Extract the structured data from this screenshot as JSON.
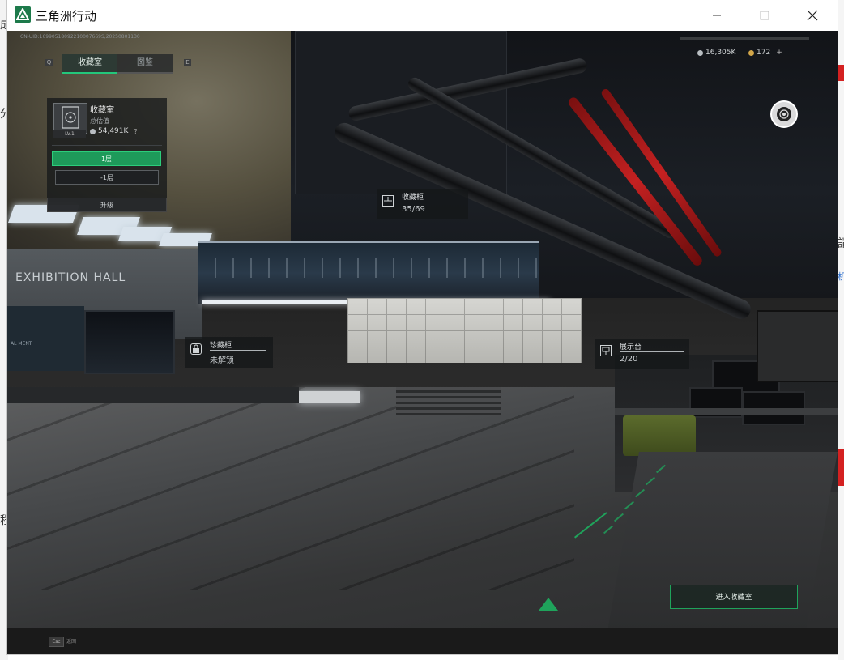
{
  "window": {
    "title": "三角洲行动",
    "controls": {
      "minimize": "—",
      "maximize": "☐",
      "close": "✕"
    }
  },
  "desktop_fragments": {
    "left_top": "成",
    "left_mid": "分",
    "left_low": "程",
    "right_a": "請",
    "right_b": "机"
  },
  "hud": {
    "uid_text": "CN-UID:16990518092210007669S,20250801130",
    "tabs": [
      {
        "label": "收藏室",
        "active": true
      },
      {
        "label": "图鉴",
        "active": false
      }
    ],
    "panel": {
      "title": "收藏室",
      "level": "LV.1",
      "value_label": "总估值",
      "value": "54,491K",
      "help": "?",
      "floors": [
        "1层",
        "-1层"
      ],
      "upgrade_label": "升级"
    },
    "currency": {
      "silver": "16,305K",
      "gold": "172",
      "add": "+"
    },
    "labels": {
      "cabinet": {
        "name": "收藏柜",
        "value": "35/69"
      },
      "treasure": {
        "name": "珍藏柜",
        "value": "未解锁"
      },
      "display": {
        "name": "展示台",
        "value": "2/20"
      }
    },
    "enter_button": "进入收藏室",
    "esc_key": "Esc",
    "esc_label": "返回"
  },
  "scene": {
    "hall_sign": "EXHIBITION HALL",
    "wall_sign": "AL MENT"
  },
  "colors": {
    "accent": "#23c77b",
    "accent_dark": "#1e9a5a",
    "pipe_red": "#c42121"
  },
  "icons": {
    "app": "delta-triangle-icon",
    "vault": "vault-door-icon",
    "silver": "silver-coin-icon",
    "gold": "gold-coin-icon",
    "camera": "camera-lens-icon",
    "cabinet": "cabinet-icon",
    "lock": "lock-icon",
    "display": "display-stand-icon"
  }
}
